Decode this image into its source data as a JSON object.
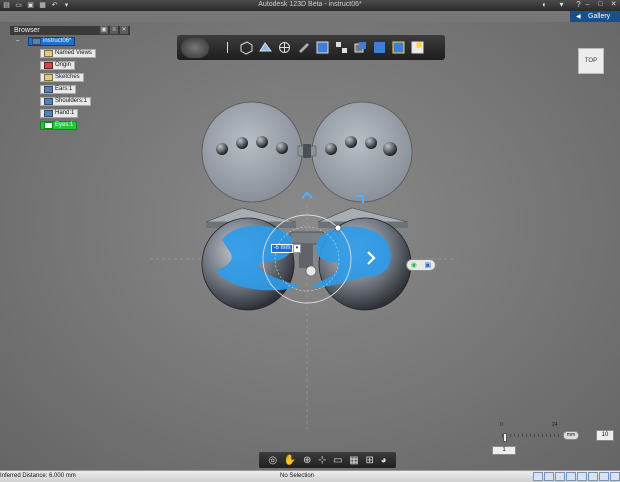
{
  "window": {
    "title": "Autodesk 123D Beta - instruct06*",
    "gallery_label": "Gallery"
  },
  "browser": {
    "title": "Browser",
    "nodes": [
      {
        "label": "instruct06*",
        "icon": "component-icon"
      },
      {
        "label": "Named Views",
        "icon": "folder-icon"
      },
      {
        "label": "Origin",
        "icon": "origin-icon"
      },
      {
        "label": "Sketches",
        "icon": "folder-icon"
      },
      {
        "label": "Ears:1",
        "icon": "body-icon"
      },
      {
        "label": "Shoulders:1",
        "icon": "body-icon"
      },
      {
        "label": "Hand:1",
        "icon": "body-icon"
      },
      {
        "label": "Eyes:1",
        "icon": "body-icon"
      }
    ]
  },
  "viewcube": {
    "label": "TOP"
  },
  "dimension": {
    "value": "-6 mm"
  },
  "slider": {
    "min_label": "0",
    "max_label": "24",
    "unit": "mm",
    "value": "10",
    "step": "1"
  },
  "status": {
    "left": "Inferred Distance: 6.000 mm",
    "mid": "No Selection"
  },
  "colors": {
    "accent": "#1f6fd1",
    "selection": "#2e9be8",
    "highlight": "#1ec93c"
  }
}
